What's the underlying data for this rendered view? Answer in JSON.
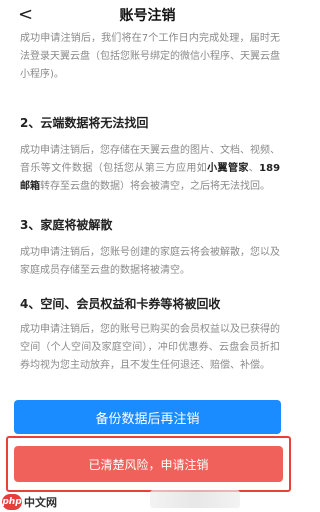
{
  "header": {
    "back_icon": "chevron-left-icon",
    "back_glyph": "<",
    "title": "账号注销"
  },
  "intro": {
    "text": "成功申请注销后，我们将在7个工作日内完成处理，届时无法登录天翼云盘（包括您账号绑定的微信小程序、天翼云盘小程序)。"
  },
  "section2": {
    "heading": "2、云端数据将无法找回",
    "text_a": "成功申请注销后，您存储在天翼云盘的图片、文档、视频、音乐等文件数据（包括您从第三方应用如",
    "bold_a": "小翼管家",
    "text_b": "、",
    "bold_b": "189邮箱",
    "text_c": "转存至云盘的数据）将会被清空，之后将无法找回。"
  },
  "section3": {
    "heading": "3、家庭将被解散",
    "text": "成功申请注销后，您账号创建的家庭云将会被解散，您以及家庭成员存储至云盘的数据将被清空。"
  },
  "section4": {
    "heading": "4、空间、会员权益和卡券等将被回收",
    "text": "成功申请注销后，您的账号已购买的会员权益以及已获得的空间（个人空间及家庭空间），冲印优惠券、云盘会员折扣券均视为您主动放弃，且不发生任何退还、赔偿、补偿。"
  },
  "actions": {
    "backup_label": "备份数据后再注销",
    "confirm_label": "已清楚风险，申请注销"
  },
  "watermark": {
    "logo": "php",
    "text": "中文网"
  },
  "colors": {
    "primary": "#1a8cff",
    "danger": "#f0615c",
    "highlight_border": "#e8413a"
  }
}
